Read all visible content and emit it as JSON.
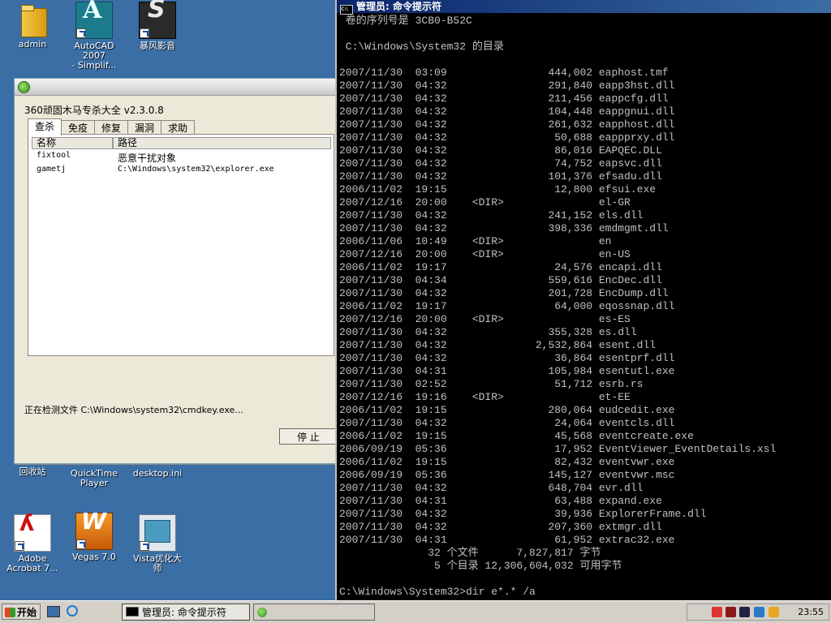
{
  "desktop": {
    "icons": {
      "admin": "admin",
      "autocad": "AutoCAD 2007\n- Simplif...",
      "baofeng": "暴风影音",
      "recycle": "回收站",
      "quicktime": "QuickTime\nPlayer",
      "desktopini": "desktop.ini",
      "acrobat": "Adobe\nAcrobat 7...",
      "vegas": "Vegas 7.0",
      "vista": "Vista优化大\n师"
    }
  },
  "w360": {
    "app_name": "360顽固木马专杀大全 v2.3.0.8",
    "tabs": [
      "查杀",
      "免疫",
      "修复",
      "漏洞",
      "求助"
    ],
    "columns": [
      "名称",
      "路径"
    ],
    "rows": [
      {
        "name": "fixtool",
        "path": "恶意干扰对象"
      },
      {
        "name": "gametj",
        "path": "C:\\Windows\\system32\\explorer.exe"
      }
    ],
    "status": "正在检测文件 C:\\Windows\\system32\\cmdkey.exe...",
    "stop_label": "停 止"
  },
  "cmd": {
    "title": "管理员: 命令提示符",
    "header": [
      " 卷的序列号是 3CB0-B52C",
      "",
      " C:\\Windows\\System32 的目录",
      ""
    ],
    "entries": [
      [
        "2007/11/30",
        "03:09",
        "",
        "444,002",
        "eaphost.tmf"
      ],
      [
        "2007/11/30",
        "04:32",
        "",
        "291,840",
        "eapp3hst.dll"
      ],
      [
        "2007/11/30",
        "04:32",
        "",
        "211,456",
        "eappcfg.dll"
      ],
      [
        "2007/11/30",
        "04:32",
        "",
        "104,448",
        "eappgnui.dll"
      ],
      [
        "2007/11/30",
        "04:32",
        "",
        "261,632",
        "eapphost.dll"
      ],
      [
        "2007/11/30",
        "04:32",
        "",
        "50,688",
        "eappprxy.dll"
      ],
      [
        "2007/11/30",
        "04:32",
        "",
        "86,016",
        "EAPQEC.DLL"
      ],
      [
        "2007/11/30",
        "04:32",
        "",
        "74,752",
        "eapsvc.dll"
      ],
      [
        "2007/11/30",
        "04:32",
        "",
        "101,376",
        "efsadu.dll"
      ],
      [
        "2006/11/02",
        "19:15",
        "",
        "12,800",
        "efsui.exe"
      ],
      [
        "2007/12/16",
        "20:00",
        "<DIR>",
        "",
        "el-GR"
      ],
      [
        "2007/11/30",
        "04:32",
        "",
        "241,152",
        "els.dll"
      ],
      [
        "2007/11/30",
        "04:32",
        "",
        "398,336",
        "emdmgmt.dll"
      ],
      [
        "2006/11/06",
        "10:49",
        "<DIR>",
        "",
        "en"
      ],
      [
        "2007/12/16",
        "20:00",
        "<DIR>",
        "",
        "en-US"
      ],
      [
        "2006/11/02",
        "19:17",
        "",
        "24,576",
        "encapi.dll"
      ],
      [
        "2007/11/30",
        "04:34",
        "",
        "559,616",
        "EncDec.dll"
      ],
      [
        "2007/11/30",
        "04:32",
        "",
        "201,728",
        "EncDump.dll"
      ],
      [
        "2006/11/02",
        "19:17",
        "",
        "64,000",
        "eqossnap.dll"
      ],
      [
        "2007/12/16",
        "20:00",
        "<DIR>",
        "",
        "es-ES"
      ],
      [
        "2007/11/30",
        "04:32",
        "",
        "355,328",
        "es.dll"
      ],
      [
        "2007/11/30",
        "04:32",
        "",
        "2,532,864",
        "esent.dll"
      ],
      [
        "2007/11/30",
        "04:32",
        "",
        "36,864",
        "esentprf.dll"
      ],
      [
        "2007/11/30",
        "04:31",
        "",
        "105,984",
        "esentutl.exe"
      ],
      [
        "2007/11/30",
        "02:52",
        "",
        "51,712",
        "esrb.rs"
      ],
      [
        "2007/12/16",
        "19:16",
        "<DIR>",
        "",
        "et-EE"
      ],
      [
        "2006/11/02",
        "19:15",
        "",
        "280,064",
        "eudcedit.exe"
      ],
      [
        "2007/11/30",
        "04:32",
        "",
        "24,064",
        "eventcls.dll"
      ],
      [
        "2006/11/02",
        "19:15",
        "",
        "45,568",
        "eventcreate.exe"
      ],
      [
        "2006/09/19",
        "05:36",
        "",
        "17,952",
        "EventViewer_EventDetails.xsl"
      ],
      [
        "2006/11/02",
        "19:15",
        "",
        "82,432",
        "eventvwr.exe"
      ],
      [
        "2006/09/19",
        "05:36",
        "",
        "145,127",
        "eventvwr.msc"
      ],
      [
        "2007/11/30",
        "04:32",
        "",
        "648,704",
        "evr.dll"
      ],
      [
        "2007/11/30",
        "04:31",
        "",
        "63,488",
        "expand.exe"
      ],
      [
        "2007/11/30",
        "04:32",
        "",
        "39,936",
        "ExplorerFrame.dll"
      ],
      [
        "2007/11/30",
        "04:32",
        "",
        "207,360",
        "extmgr.dll"
      ],
      [
        "2007/11/30",
        "04:31",
        "",
        "61,952",
        "extrac32.exe"
      ]
    ],
    "summary": [
      "              32 个文件      7,827,817 字节",
      "               5 个目录 12,306,604,032 可用字节"
    ],
    "prompt": "C:\\Windows\\System32>dir e*.* /a"
  },
  "taskbar": {
    "start_label": "开始",
    "tasks": [
      "管理员: 命令提示符",
      ""
    ],
    "clock": "23:55"
  }
}
